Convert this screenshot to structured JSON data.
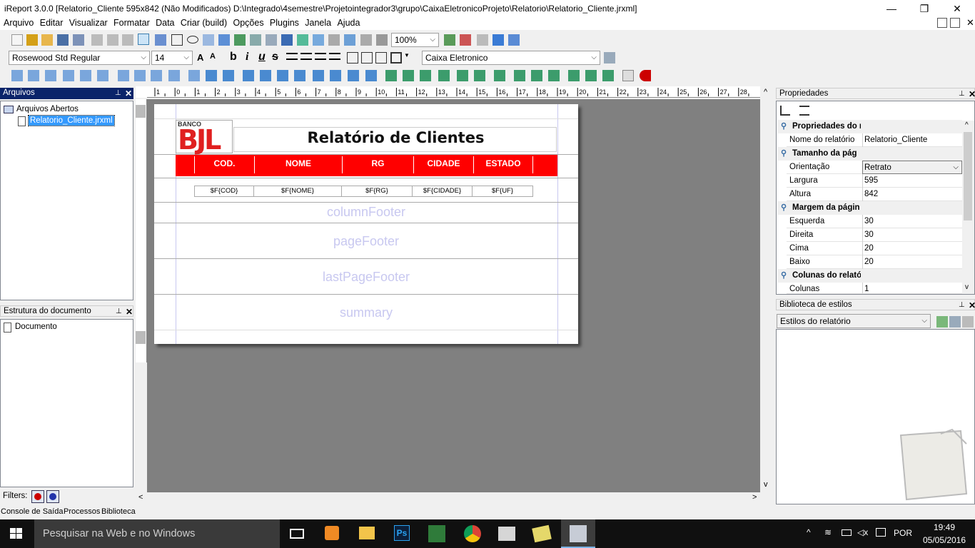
{
  "title": "iReport 3.0.0  [Relatorio_Cliente 595x842 (Não Modificados) D:\\Integrado\\4semestre\\Projetointegrador3\\grupo\\CaixaEletronicoProjeto\\Relatorio\\Relatorio_Cliente.jrxml]",
  "window_controls": {
    "minimize": "—",
    "restore": "❐",
    "close": "✕"
  },
  "menu": [
    "Arquivo",
    "Editar",
    "Visualizar",
    "Formatar",
    "Data",
    "Criar (build)",
    "Opções",
    "Plugins",
    "Janela",
    "Ajuda"
  ],
  "toolbar": {
    "zoom": "100%",
    "font_name": "Rosewood Std Regular",
    "font_size": "14",
    "datasource": "Caixa Eletronico",
    "bold": "b",
    "italic": "i",
    "underline": "u",
    "strike": "s"
  },
  "files_panel": {
    "title": "Arquivos",
    "root": "Arquivos Abertos",
    "file": "Relatorio_Cliente.jrxml"
  },
  "structure_panel": {
    "title": "Estrutura do documento",
    "root": "Documento"
  },
  "filters_label": "Filters:",
  "bottom_tabs": [
    "Console de Saída",
    "Processos",
    "Biblioteca"
  ],
  "ruler_numbers": [
    "1",
    "0",
    "1",
    "2",
    "3",
    "4",
    "5",
    "6",
    "7",
    "8",
    "9",
    "10",
    "11",
    "12",
    "13",
    "14",
    "15",
    "16",
    "17",
    "18",
    "19",
    "20",
    "21",
    "22",
    "23",
    "24",
    "25",
    "26",
    "27",
    "28"
  ],
  "report": {
    "logo_small": "BANCO",
    "logo_big": "BJL",
    "title": "Relatório de Clientes",
    "header_color": "#ff0000",
    "columns": [
      "COD.",
      "NOME",
      "RG",
      "CIDADE",
      "ESTADO"
    ],
    "fields": [
      "$F{COD}",
      "$F{NOME}",
      "$F{RG}",
      "$F{CIDADE}",
      "$F{UF}"
    ],
    "band_labels": [
      "columnFooter",
      "pageFooter",
      "lastPageFooter",
      "summary"
    ]
  },
  "properties_panel": {
    "title": "Propriedades",
    "categories": [
      "Propriedades do r",
      "Tamanho da pág",
      "Margem da págin",
      "Colunas do relató"
    ],
    "rows": [
      {
        "key": "Nome do relatório",
        "value": "Relatorio_Cliente"
      },
      {
        "key": "Orientação",
        "value": "Retrato"
      },
      {
        "key": "Largura",
        "value": "595"
      },
      {
        "key": "Altura",
        "value": "842"
      },
      {
        "key": "Esquerda",
        "value": "30"
      },
      {
        "key": "Direita",
        "value": "30"
      },
      {
        "key": "Cima",
        "value": "20"
      },
      {
        "key": "Baixo",
        "value": "20"
      },
      {
        "key": "Colunas",
        "value": "1"
      }
    ]
  },
  "styles_panel": {
    "title": "Biblioteca de estilos",
    "selected": "Estilos do relatório"
  },
  "taskbar": {
    "search_placeholder": "Pesquisar na Web e no Windows",
    "language": "POR",
    "time": "19:49",
    "date": "05/05/2016"
  }
}
